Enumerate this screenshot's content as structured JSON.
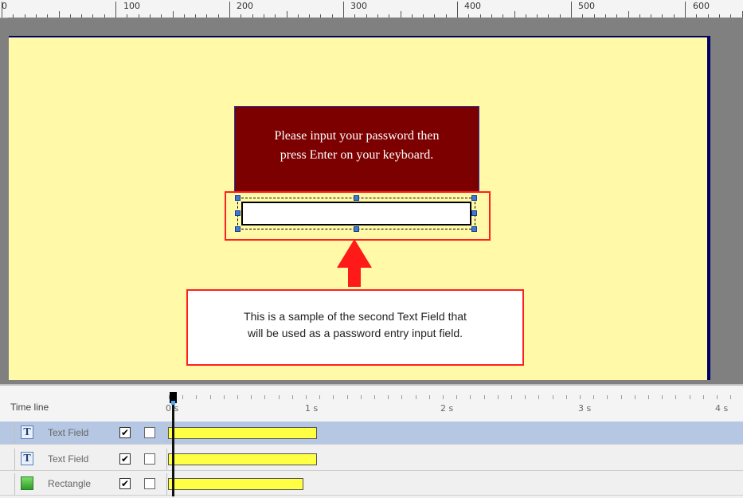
{
  "ruler": {
    "labels": [
      "0",
      "100",
      "200",
      "300",
      "400",
      "500",
      "600"
    ]
  },
  "stage": {
    "message_line1": "Please input your password then",
    "message_line2": "press Enter on your keyboard.",
    "password_field_value": "",
    "callout_line1": "This is a sample of the second Text Field that",
    "callout_line2": "will be used as a password entry input field."
  },
  "timeline": {
    "label": "Time line",
    "time_marks": [
      "0 s",
      "1 s",
      "2 s",
      "3 s",
      "4 s"
    ],
    "rows": [
      {
        "name": "Text Field",
        "icon": "text-field-icon",
        "visible_checked": "✔",
        "selected": true
      },
      {
        "name": "Text Field",
        "icon": "text-field-icon",
        "visible_checked": "✔",
        "selected": false
      },
      {
        "name": "Rectangle",
        "icon": "rectangle-icon",
        "visible_checked": "✔",
        "selected": false
      }
    ]
  },
  "colors": {
    "stage_bg": "#fff9a8",
    "message_bg": "#7d0000",
    "highlight": "#ff2020",
    "timeline_bar": "#ffff44",
    "selected_row": "#b5c7e3"
  }
}
